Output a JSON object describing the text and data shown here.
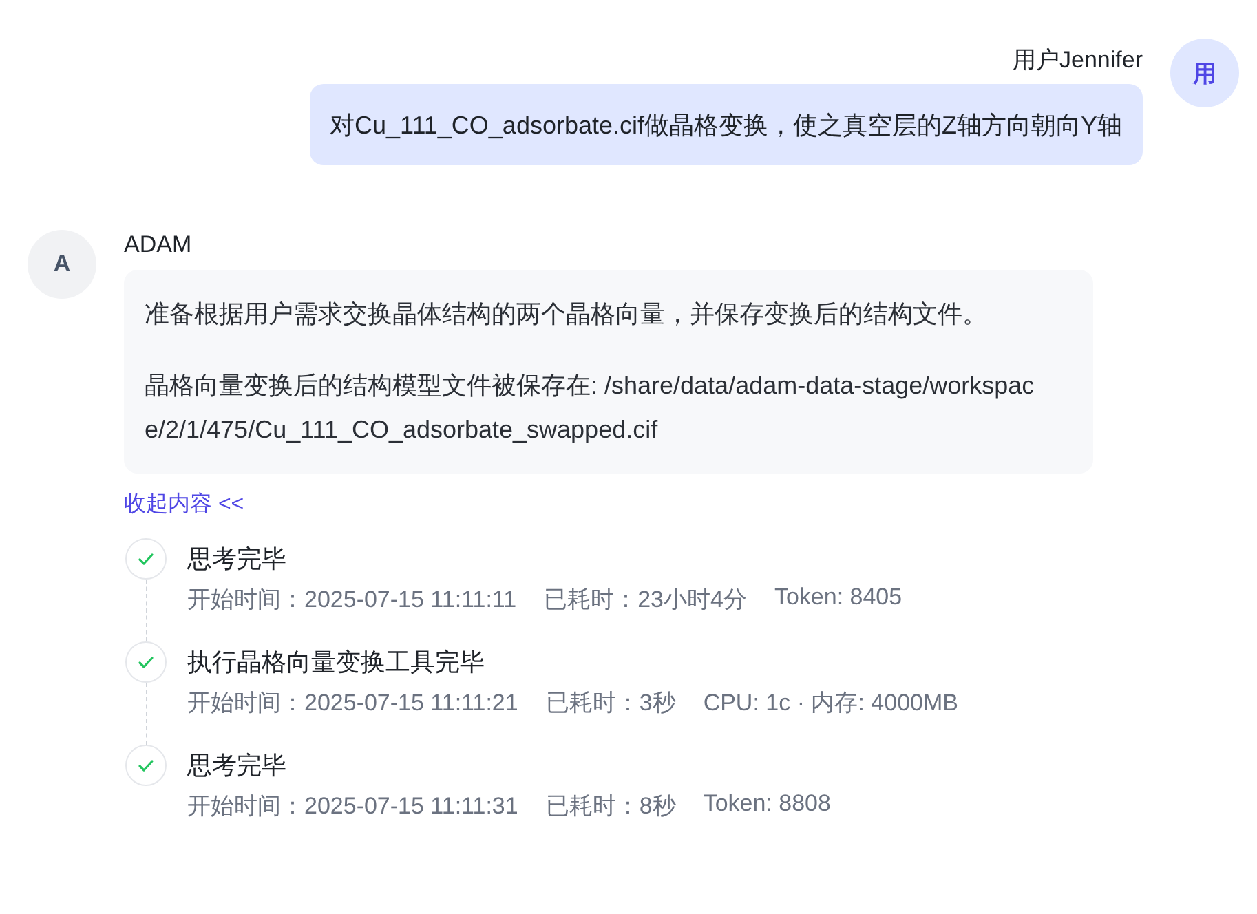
{
  "user_message": {
    "avatar": "用",
    "name": "用户Jennifer",
    "text": "对Cu_111_CO_adsorbate.cif做晶格变换，使之真空层的Z轴方向朝向Y轴"
  },
  "assistant_message": {
    "avatar": "A",
    "name": "ADAM",
    "paragraphs": [
      "准备根据用户需求交换晶体结构的两个晶格向量，并保存变换后的结构文件。",
      "晶格向量变换后的结构模型文件被保存在: /share/data/adam-data-stage/workspace/2/1/475/Cu_111_CO_adsorbate_swapped.cif"
    ],
    "collapse_link": "收起内容 <<"
  },
  "steps": [
    {
      "title": "思考完毕",
      "done": true,
      "meta": [
        "开始时间：2025-07-15 11:11:11",
        "已耗时：23小时4分",
        "Token: 8405"
      ]
    },
    {
      "title": "执行晶格向量变换工具完毕",
      "done": true,
      "meta": [
        "开始时间：2025-07-15 11:11:21",
        "已耗时：3秒",
        "CPU: 1c · 内存: 4000MB"
      ]
    },
    {
      "title": "思考完毕",
      "done": true,
      "meta": [
        "开始时间：2025-07-15 11:11:31",
        "已耗时：8秒",
        "Token: 8808"
      ]
    }
  ]
}
